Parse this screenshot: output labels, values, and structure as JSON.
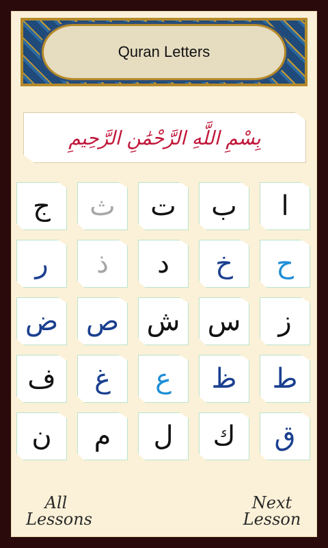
{
  "header": {
    "title": "Quran Letters"
  },
  "bismillah": {
    "text": "بِسْمِ اللَّهِ الرَّحْمَٰنِ الرَّحِيمِ"
  },
  "letters": [
    {
      "char": "ج",
      "color": "black"
    },
    {
      "char": "ث",
      "color": "gray"
    },
    {
      "char": "ت",
      "color": "black"
    },
    {
      "char": "ب",
      "color": "black"
    },
    {
      "char": "ا",
      "color": "black"
    },
    {
      "char": "ر",
      "color": "navy"
    },
    {
      "char": "ذ",
      "color": "gray"
    },
    {
      "char": "د",
      "color": "black"
    },
    {
      "char": "خ",
      "color": "navy"
    },
    {
      "char": "ح",
      "color": "blue"
    },
    {
      "char": "ض",
      "color": "navy"
    },
    {
      "char": "ص",
      "color": "navy"
    },
    {
      "char": "ش",
      "color": "black"
    },
    {
      "char": "س",
      "color": "black"
    },
    {
      "char": "ز",
      "color": "black"
    },
    {
      "char": "ف",
      "color": "black"
    },
    {
      "char": "غ",
      "color": "navy"
    },
    {
      "char": "ع",
      "color": "blue"
    },
    {
      "char": "ظ",
      "color": "navy"
    },
    {
      "char": "ط",
      "color": "navy"
    },
    {
      "char": "ن",
      "color": "black"
    },
    {
      "char": "م",
      "color": "black"
    },
    {
      "char": "ل",
      "color": "black"
    },
    {
      "char": "ك",
      "color": "black"
    },
    {
      "char": "ق",
      "color": "navy"
    }
  ],
  "colors": {
    "black": "#111111",
    "gray": "#a7a7a7",
    "navy": "#1a3f8f",
    "blue": "#1f8fd6",
    "bismillah": "#c0173a"
  },
  "footer": {
    "all_lessons_line1": "All",
    "all_lessons_line2": "Lessons",
    "next_lesson_line1": "Next",
    "next_lesson_line2": "Lesson"
  }
}
